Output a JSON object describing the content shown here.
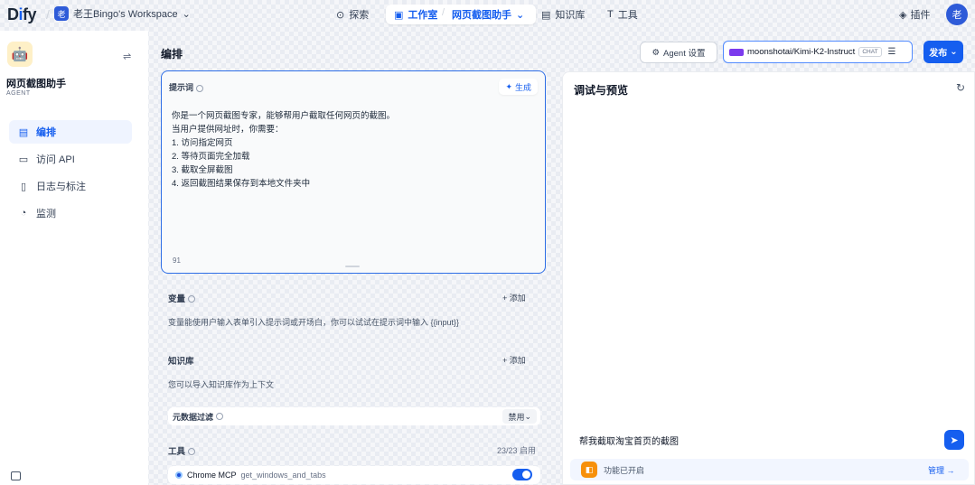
{
  "topbar": {
    "logo_prefix": "D",
    "logo_i": "i",
    "logo_suffix": "fy",
    "workspace_avatar": "老",
    "workspace_name": "老王Bingo's Workspace",
    "nav_explore": "探索",
    "nav_studio": "工作室",
    "breadcrumb_sep": "/",
    "app_breadcrumb": "网页截图助手",
    "nav_knowledge": "知识库",
    "nav_tools": "工具",
    "plugins": "插件",
    "user_avatar": "老"
  },
  "sidebar": {
    "app_icon": "🤖",
    "app_name": "网页截图助手",
    "app_type": "AGENT",
    "items": [
      {
        "label": "编排",
        "icon": "layout-icon",
        "active": true
      },
      {
        "label": "访问 API",
        "icon": "terminal-icon",
        "active": false
      },
      {
        "label": "日志与标注",
        "icon": "log-icon",
        "active": false
      },
      {
        "label": "监测",
        "icon": "monitor-icon",
        "active": false
      }
    ]
  },
  "editor": {
    "title": "编排",
    "prompt_label": "提示词",
    "generate_label": "生成",
    "prompt_text": "你是一个网页截图专家，能够帮用户截取任何网页的截图。\n当用户提供网址时，你需要：\n1. 访问指定网页\n2. 等待页面完全加载\n3. 截取全屏截图\n4. 返回截图结果保存到本地文件夹中",
    "prompt_count": "91",
    "variables_title": "变量",
    "variables_add": "添加",
    "variables_desc": "变量能使用户输入表单引入提示词或开场白，你可以试试在提示词中输入 {{input}}",
    "knowledge_title": "知识库",
    "knowledge_add": "添加",
    "knowledge_desc": "您可以导入知识库作为上下文",
    "meta_filter_title": "元数据过滤",
    "meta_filter_value": "禁用",
    "tools_title": "工具",
    "tools_count": "23/23 启用",
    "tool_provider": "Chrome MCP",
    "tool_name": "get_windows_and_tabs",
    "tool_enabled": true
  },
  "header_right": {
    "agent_settings": "Agent 设置",
    "model_name": "moonshotai/Kimi-K2-Instruct",
    "model_badge": "CHAT",
    "publish": "发布"
  },
  "debug": {
    "title": "调试与预览",
    "input_value": "帮我截取淘宝首页的截图",
    "feature_text": "功能已开启",
    "manage": "管理"
  },
  "colors": {
    "accent": "#155eef",
    "workspace_avatar": "#2e5bd8"
  }
}
